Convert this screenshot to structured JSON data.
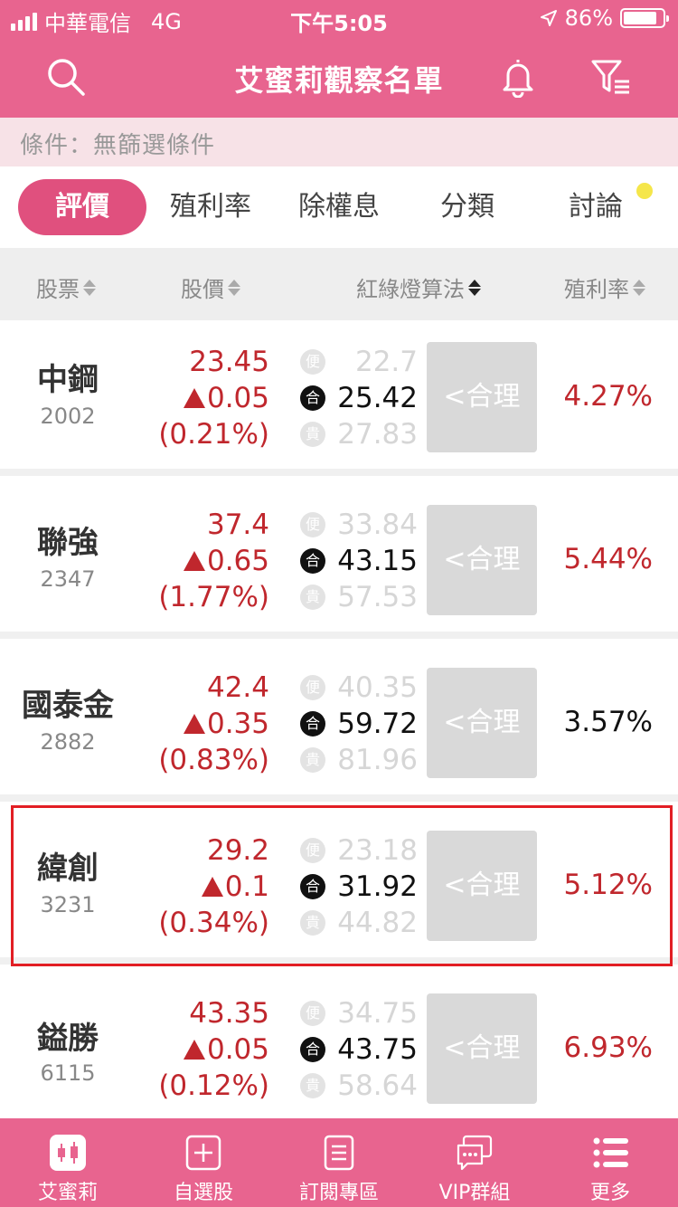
{
  "status_bar": {
    "carrier": "中華電信",
    "network": "4G",
    "time": "下午5:05",
    "battery": "86%"
  },
  "header": {
    "title": "艾蜜莉觀察名單",
    "icons": [
      "search-icon",
      "bell-icon",
      "filter-icon"
    ]
  },
  "condition": {
    "text": "條件：無篩選條件"
  },
  "tabs": [
    {
      "label": "評價",
      "active": true
    },
    {
      "label": "殖利率"
    },
    {
      "label": "除權息"
    },
    {
      "label": "分類"
    },
    {
      "label": "討論",
      "notify_dot": true
    }
  ],
  "columns": {
    "stock": "股票",
    "price": "股價",
    "algo": "紅綠燈算法",
    "yield": "殖利率"
  },
  "value_labels": {
    "cheap": "便",
    "fair": "合",
    "expensive": "貴"
  },
  "rows": [
    {
      "name": "中鋼",
      "code": "2002",
      "price": "23.45",
      "change": "0.05",
      "pct": "(0.21%)",
      "cheap": "22.7",
      "fair": "25.42",
      "expensive": "27.83",
      "badge": "<合理",
      "yield": "4.27%"
    },
    {
      "name": "聯強",
      "code": "2347",
      "price": "37.4",
      "change": "0.65",
      "pct": "(1.77%)",
      "cheap": "33.84",
      "fair": "43.15",
      "expensive": "57.53",
      "badge": "<合理",
      "yield": "5.44%"
    },
    {
      "name": "國泰金",
      "code": "2882",
      "price": "42.4",
      "change": "0.35",
      "pct": "(0.83%)",
      "cheap": "40.35",
      "fair": "59.72",
      "expensive": "81.96",
      "badge": "<合理",
      "yield": "3.57%"
    },
    {
      "name": "緯創",
      "code": "3231",
      "price": "29.2",
      "change": "0.1",
      "pct": "(0.34%)",
      "cheap": "23.18",
      "fair": "31.92",
      "expensive": "44.82",
      "badge": "<合理",
      "yield": "5.12%"
    },
    {
      "name": "鎰勝",
      "code": "6115",
      "price": "43.35",
      "change": "0.05",
      "pct": "(0.12%)",
      "cheap": "34.75",
      "fair": "43.75",
      "expensive": "58.64",
      "badge": "<合理",
      "yield": "6.93%"
    }
  ],
  "bottom_nav": [
    {
      "label": "艾蜜莉",
      "icon": "candlestick-icon"
    },
    {
      "label": "自選股",
      "icon": "add-box-icon"
    },
    {
      "label": "訂閱專區",
      "icon": "document-icon"
    },
    {
      "label": "VIP群組",
      "icon": "chat-icon"
    },
    {
      "label": "更多",
      "icon": "menu-list-icon"
    }
  ],
  "colors": {
    "brand": "#e8648f",
    "active_tab": "#e0507e",
    "up": "#c0272d",
    "highlight_frame": "#e21e24"
  }
}
